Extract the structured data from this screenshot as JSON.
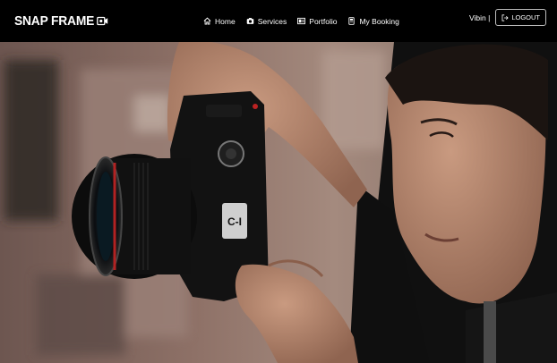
{
  "brand": {
    "name": "SNAP FRAME",
    "icon": "video-camera-icon"
  },
  "nav": {
    "items": [
      {
        "label": "Home",
        "icon": "home-icon"
      },
      {
        "label": "Services",
        "icon": "camera-icon"
      },
      {
        "label": "Portfolio",
        "icon": "portfolio-icon"
      },
      {
        "label": "My Booking",
        "icon": "booking-icon"
      }
    ]
  },
  "user": {
    "name": "Vibin |",
    "logout_label": "LOGOUT",
    "logout_icon": "logout-icon"
  },
  "hero": {
    "image": "photographer-with-camera"
  }
}
